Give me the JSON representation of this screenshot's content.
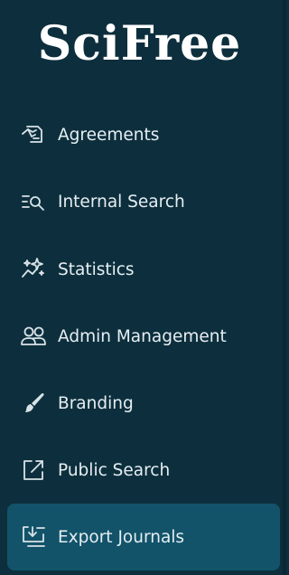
{
  "app": {
    "brand": "SciFree"
  },
  "sidebar": {
    "items": [
      {
        "label": "Agreements",
        "icon": "handshake-document-icon",
        "active": false
      },
      {
        "label": "Internal Search",
        "icon": "list-search-icon",
        "active": false
      },
      {
        "label": "Statistics",
        "icon": "sparkle-trend-icon",
        "active": false
      },
      {
        "label": "Admin Management",
        "icon": "people-icon",
        "active": false
      },
      {
        "label": "Branding",
        "icon": "paintbrush-icon",
        "active": false
      },
      {
        "label": "Public Search",
        "icon": "external-link-icon",
        "active": false
      },
      {
        "label": "Export Journals",
        "icon": "export-download-icon",
        "active": true
      }
    ]
  },
  "colors": {
    "background": "#0d2f3d",
    "active_background": "#12536a",
    "text": "#e6eef2"
  }
}
